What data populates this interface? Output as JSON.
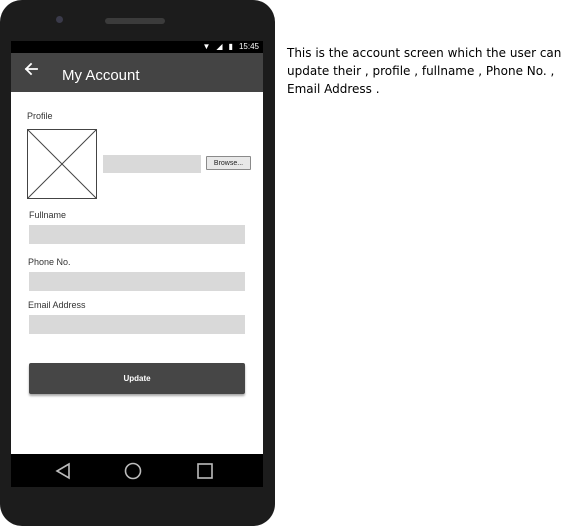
{
  "statusbar": {
    "time": "15:45"
  },
  "appbar": {
    "title": "My Account",
    "back_icon": "arrow-left-icon"
  },
  "form": {
    "profile_label": "Profile",
    "browse_label": "Browse...",
    "fullname_label": "Fullname",
    "fullname_value": "",
    "phone_label": "Phone No.",
    "phone_value": "",
    "email_label": "Email Address",
    "email_value": "",
    "update_label": "Update"
  },
  "navbar": {
    "icons": [
      "back-triangle-icon",
      "home-circle-icon",
      "recents-square-icon"
    ]
  },
  "description": "This is the account screen which the user can update their , profile , fullname , Phone No. , Email Address .",
  "colors": {
    "appbar": "#444444",
    "button": "#464646",
    "field": "#d9d9d9",
    "frame": "#1c1c1c"
  }
}
